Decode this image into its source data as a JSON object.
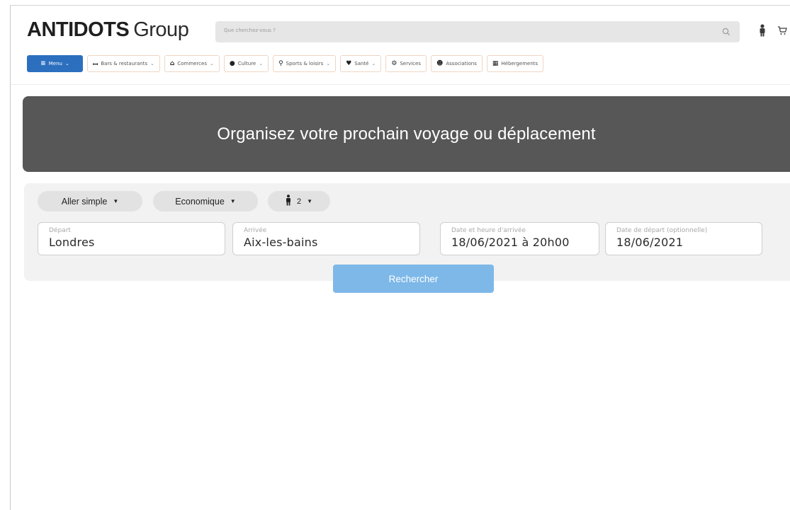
{
  "header": {
    "brand_bold": "ANTIDOTS",
    "brand_light": "Group",
    "search_placeholder": "Que cherchez-vous ?",
    "icons": [
      "search-icon",
      "user-icon",
      "cart-icon"
    ]
  },
  "nav": {
    "menu_label": "Menu",
    "items": [
      {
        "label": "Bars & restaurants",
        "icon": "restaurant-icon",
        "has_caret": true
      },
      {
        "label": "Commerces",
        "icon": "store-icon",
        "has_caret": true
      },
      {
        "label": "Culture",
        "icon": "theatre-icon",
        "has_caret": true
      },
      {
        "label": "Sports & loisirs",
        "icon": "sports-icon",
        "has_caret": true
      },
      {
        "label": "Santé",
        "icon": "heart-icon",
        "has_caret": true
      },
      {
        "label": "Services",
        "icon": "cogs-icon",
        "has_caret": false
      },
      {
        "label": "Associations",
        "icon": "users-icon",
        "has_caret": false
      },
      {
        "label": "Hébergements",
        "icon": "building-icon",
        "has_caret": false
      }
    ]
  },
  "banner": {
    "title": "Organisez votre prochain voyage ou déplacement"
  },
  "trip": {
    "trip_type": "Aller simple",
    "travel_class": "Economique",
    "passengers": "2",
    "fields": {
      "departure": {
        "label": "Départ",
        "value": "Londres"
      },
      "arrival": {
        "label": "Arrivée",
        "value": "Aix-les-bains"
      },
      "arrival_datetime": {
        "label": "Date et heure d'arrivée",
        "value": "18/06/2021 à 20h00"
      },
      "return_date": {
        "label": "Date de départ (optionnelle)",
        "value": "18/06/2021"
      }
    },
    "search_button": "Rechercher"
  },
  "colors": {
    "menu_button": "#2c6fbf",
    "banner_bg": "#575757",
    "panel_bg": "#f2f2f2",
    "search_button": "#7db8e8"
  }
}
